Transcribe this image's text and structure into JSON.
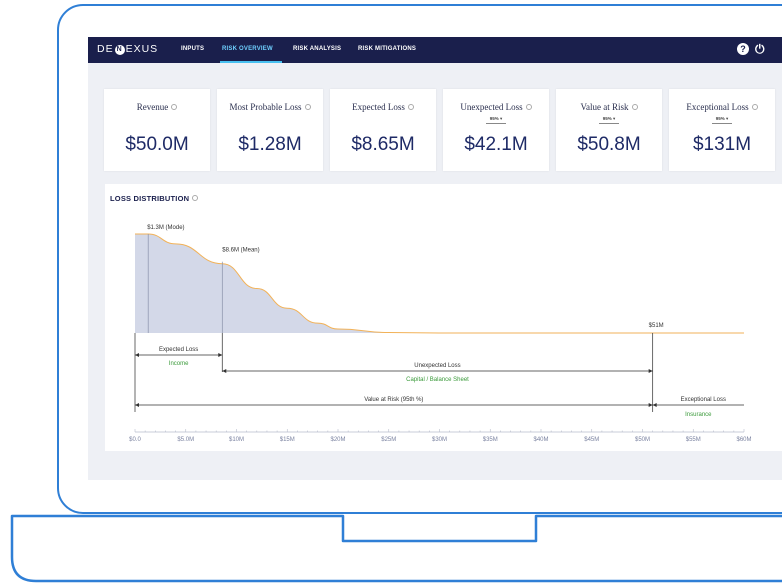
{
  "nav": {
    "logo": "DENEXUS",
    "tabs": [
      {
        "label": "INPUTS"
      },
      {
        "label": "RISK OVERVIEW",
        "active": true
      },
      {
        "label": "RISK ANALYSIS"
      },
      {
        "label": "RISK MITIGATIONS"
      }
    ],
    "icons": [
      "help-icon",
      "power-icon"
    ]
  },
  "cards": [
    {
      "label": "Revenue",
      "value": "$50.0M"
    },
    {
      "label": "Most Probable Loss",
      "value": "$1.28M"
    },
    {
      "label": "Expected Loss",
      "value": "$8.65M"
    },
    {
      "label": "Unexpected Loss",
      "selector": "95%",
      "value": "$42.1M"
    },
    {
      "label": "Value at Risk",
      "selector": "95%",
      "value": "$50.8M"
    },
    {
      "label": "Exceptional Loss",
      "selector": "95%",
      "value": "$131M"
    }
  ],
  "loss_distribution": {
    "title": "LOSS DISTRIBUTION",
    "annotations": {
      "mode": "$1.3M (Mode)",
      "mean": "$8.6M (Mean)",
      "var": "$51M"
    },
    "ranges": [
      {
        "label": "Expected Loss",
        "sublabel": "Income"
      },
      {
        "label": "Unexpected Loss",
        "sublabel": "Capital / Balance Sheet"
      },
      {
        "label": "Value at Risk (95th %)"
      },
      {
        "label": "Exceptional Loss",
        "sublabel": "Insurance"
      }
    ]
  },
  "chart_data": {
    "type": "area",
    "title": "LOSS DISTRIBUTION",
    "x_ticks": [
      "$0.0",
      "$5.0M",
      "$10M",
      "$15M",
      "$20M",
      "$25M",
      "$30M",
      "$35M",
      "$40M",
      "$45M",
      "$50M",
      "$55M",
      "$60M"
    ],
    "xlim": [
      0,
      60
    ],
    "x_unit": "$M",
    "markers": [
      {
        "x": 1.3,
        "label": "$1.3M (Mode)"
      },
      {
        "x": 8.6,
        "label": "$8.6M (Mean)"
      },
      {
        "x": 51,
        "label": "$51M"
      }
    ],
    "curve": {
      "x": [
        0,
        1.3,
        4,
        8.6,
        12,
        15,
        18,
        20,
        25,
        30,
        60
      ],
      "y": [
        1.0,
        1.0,
        0.9,
        0.7,
        0.45,
        0.25,
        0.1,
        0.04,
        0.005,
        0.0,
        0.0
      ]
    },
    "colors": {
      "fill": "#d3d8e8",
      "line": "#f2b258",
      "text": "#2a2f4e",
      "green": "#3a9a3a"
    }
  },
  "colors": {
    "frame": "#2f7fd6",
    "nav": "#1a1f4c",
    "accent": "#48c0f0",
    "value": "#1e2a66"
  }
}
